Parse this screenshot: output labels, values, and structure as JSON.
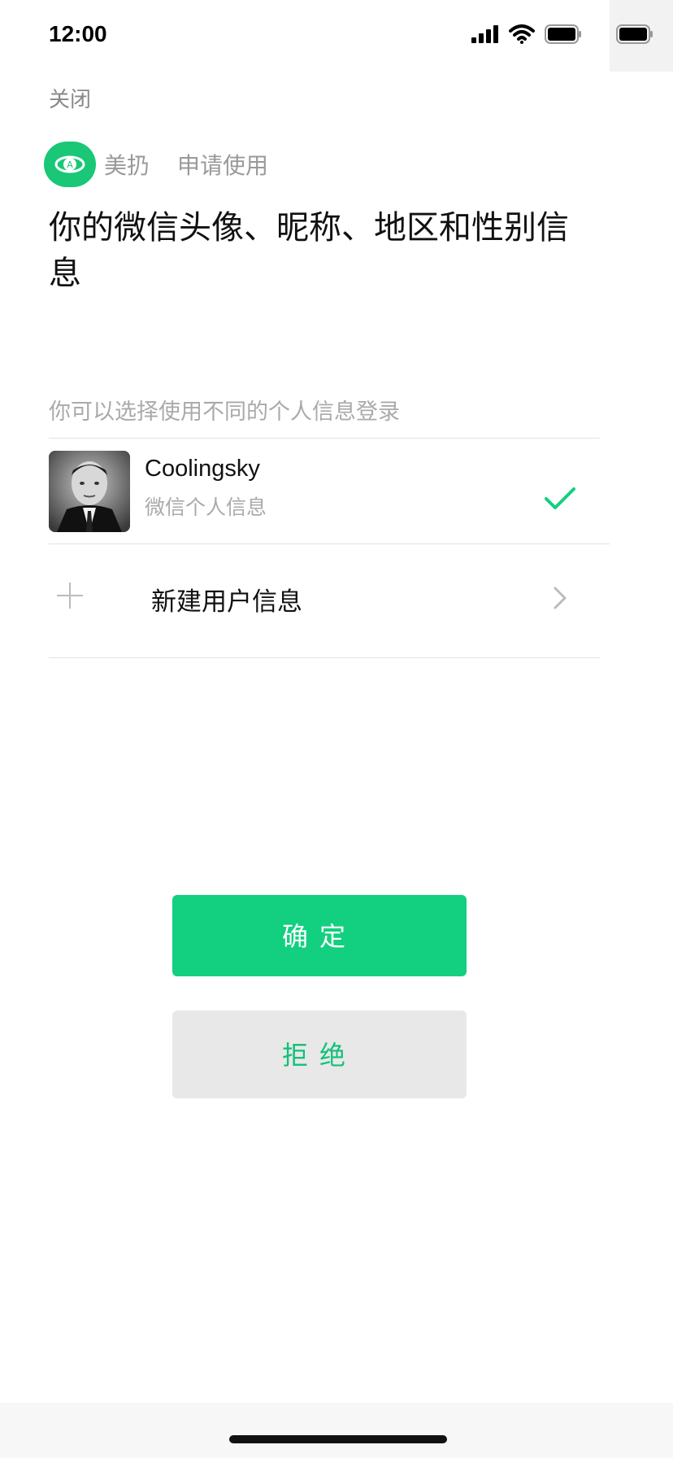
{
  "status": {
    "time": "12:00",
    "icons": [
      "cellular-signal-icon",
      "wifi-icon",
      "battery-icon",
      "battery-icon"
    ]
  },
  "header": {
    "close_label": "关闭"
  },
  "app": {
    "name": "美扔",
    "request_text": "申请使用",
    "logo_color": "#19c777"
  },
  "permission": {
    "title": "你的微信头像、昵称、地区和性别信息"
  },
  "profiles": {
    "hint": "你可以选择使用不同的个人信息登录",
    "items": [
      {
        "name": "Coolingsky",
        "subtitle": "微信个人信息",
        "selected": true
      }
    ],
    "new_label": "新建用户信息"
  },
  "actions": {
    "confirm_label": "确定",
    "reject_label": "拒绝",
    "accent_color": "#12d07f"
  }
}
